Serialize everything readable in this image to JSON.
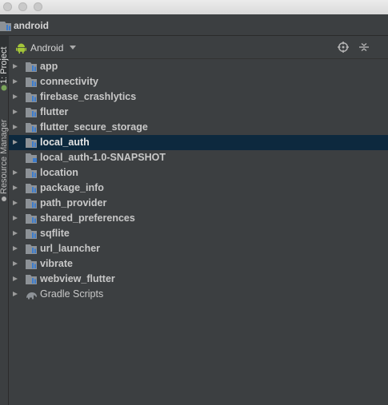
{
  "navbar": {
    "project_name": "android"
  },
  "tool_window_stripe": {
    "project_tab": "1: Project",
    "resource_manager_tab": "Resource Manager"
  },
  "panel": {
    "view_mode": "Android"
  },
  "tree": [
    {
      "label": "app",
      "kind": "module",
      "expandable": true
    },
    {
      "label": "connectivity",
      "kind": "module",
      "expandable": true
    },
    {
      "label": "firebase_crashlytics",
      "kind": "module",
      "expandable": true
    },
    {
      "label": "flutter",
      "kind": "module",
      "expandable": true
    },
    {
      "label": "flutter_secure_storage",
      "kind": "module",
      "expandable": true
    },
    {
      "label": "local_auth",
      "kind": "module",
      "expandable": true,
      "selected": true
    },
    {
      "label": "local_auth-1.0-SNAPSHOT",
      "kind": "library",
      "expandable": false
    },
    {
      "label": "location",
      "kind": "module",
      "expandable": true
    },
    {
      "label": "package_info",
      "kind": "module",
      "expandable": true
    },
    {
      "label": "path_provider",
      "kind": "module",
      "expandable": true
    },
    {
      "label": "shared_preferences",
      "kind": "module",
      "expandable": true
    },
    {
      "label": "sqflite",
      "kind": "module",
      "expandable": true
    },
    {
      "label": "url_launcher",
      "kind": "module",
      "expandable": true
    },
    {
      "label": "vibrate",
      "kind": "module",
      "expandable": true
    },
    {
      "label": "webview_flutter",
      "kind": "module",
      "expandable": true
    },
    {
      "label": "Gradle Scripts",
      "kind": "gradle",
      "expandable": true
    }
  ],
  "colors": {
    "background": "#3c3f41",
    "selection": "#0d293e",
    "text": "#c8c8c8",
    "android_green": "#a4c639"
  },
  "icons": {
    "module": "module-folder-icon",
    "library": "library-folder-icon",
    "gradle": "gradle-elephant-icon",
    "view_mode": "android-icon",
    "locate": "crosshair-icon",
    "collapse": "collapse-all-icon"
  }
}
